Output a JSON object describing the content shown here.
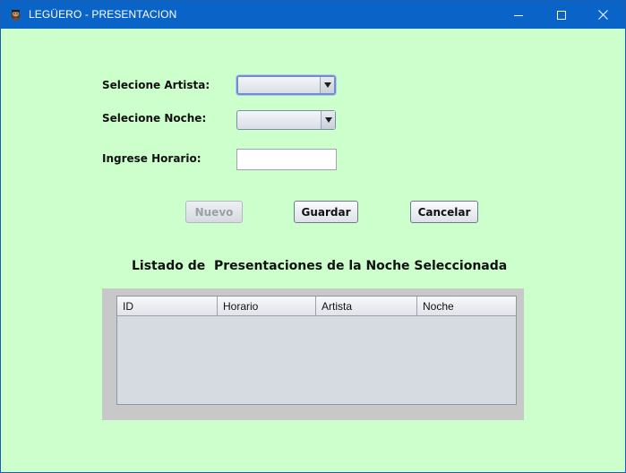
{
  "window": {
    "title": "LEGÜERO - PRESENTACION"
  },
  "form": {
    "artista_label": "Selecione Artista:",
    "artista_value": "",
    "noche_label": "Selecione Noche:",
    "noche_value": "",
    "horario_label": "Ingrese Horario:",
    "horario_value": ""
  },
  "buttons": {
    "nuevo": "Nuevo",
    "guardar": "Guardar",
    "cancelar": "Cancelar"
  },
  "listado": {
    "title": "Listado de  Presentaciones de la Noche Seleccionada",
    "columns": [
      "ID",
      "Horario",
      "Artista",
      "Noche"
    ],
    "rows": []
  },
  "colors": {
    "titlebar": "#0a64c8",
    "background": "#ccffcc",
    "table_panel": "#c8c8c8"
  },
  "icons": {
    "app": "app-icon",
    "minimize": "minimize-icon",
    "maximize": "maximize-icon",
    "close": "close-icon",
    "dropdown": "chevron-down-icon"
  }
}
